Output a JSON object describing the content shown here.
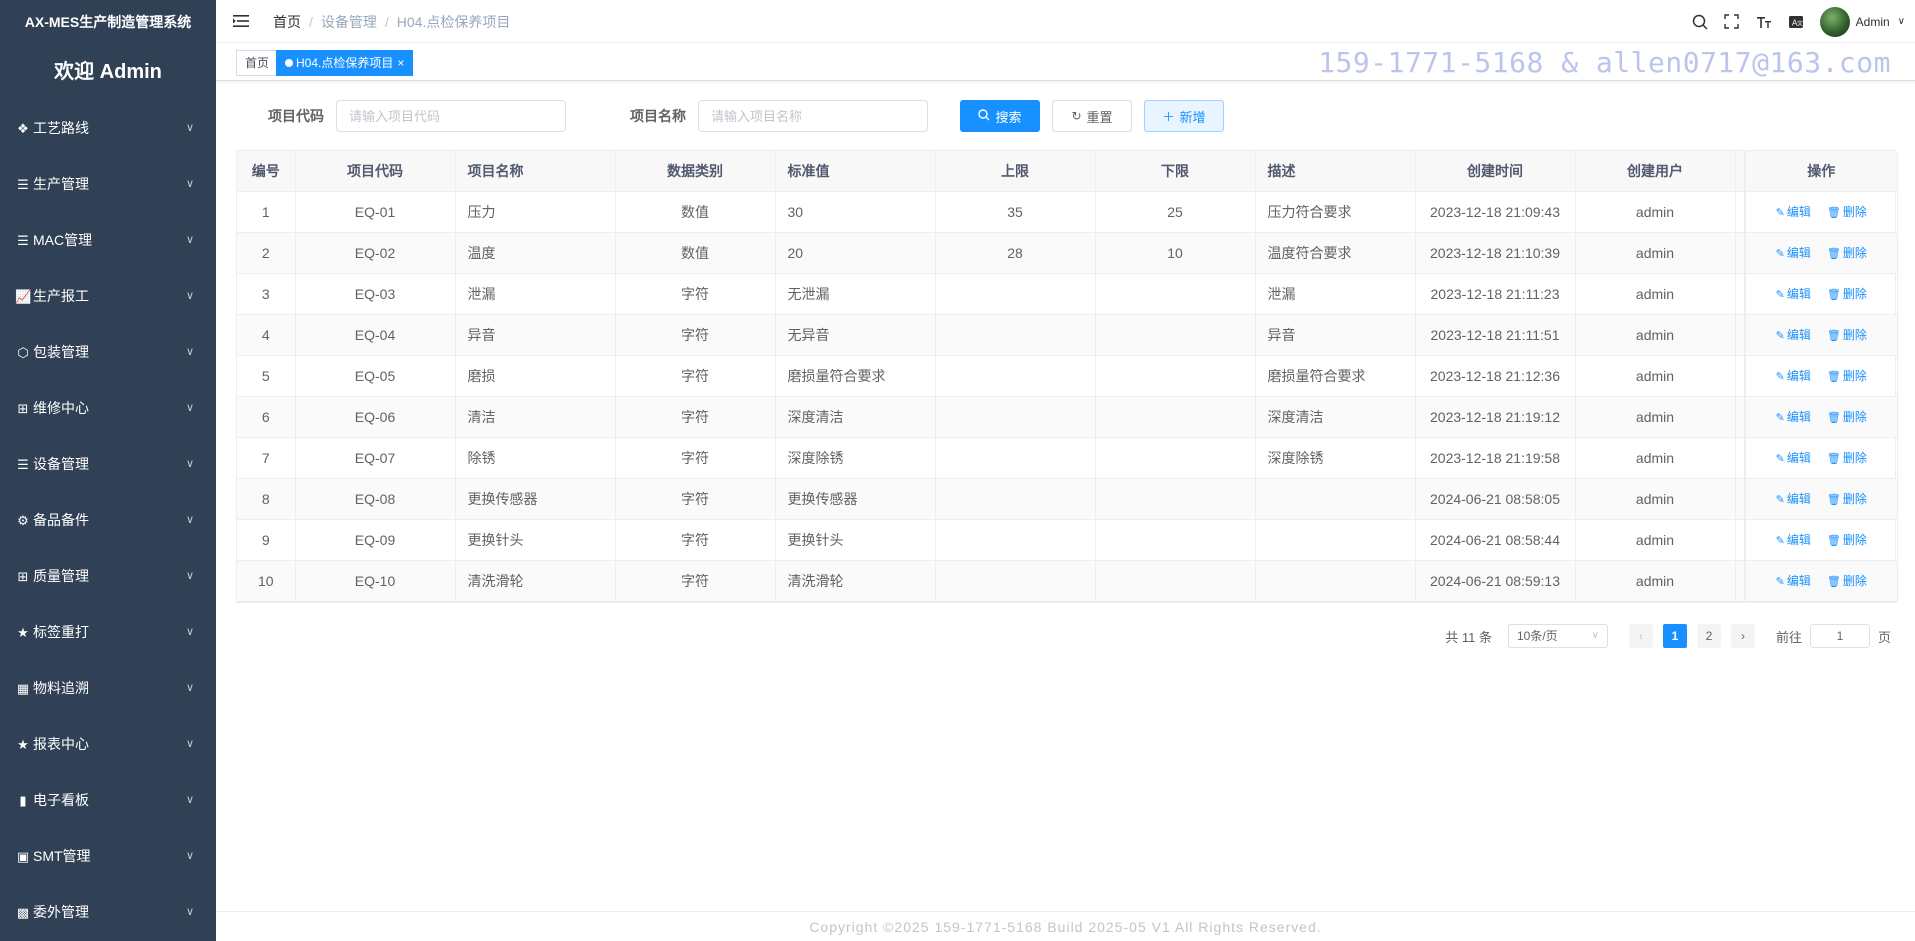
{
  "sidebar": {
    "system_title": "AX-MES生产制造管理系统",
    "welcome": "欢迎 Admin",
    "items": [
      {
        "label": "工艺路线",
        "icon": "route-icon"
      },
      {
        "label": "生产管理",
        "icon": "list-icon"
      },
      {
        "label": "MAC管理",
        "icon": "list-icon"
      },
      {
        "label": "生产报工",
        "icon": "chart-report-icon"
      },
      {
        "label": "包装管理",
        "icon": "box-icon"
      },
      {
        "label": "维修中心",
        "icon": "grid-icon"
      },
      {
        "label": "设备管理",
        "icon": "list-icon"
      },
      {
        "label": "备品备件",
        "icon": "puzzle-icon"
      },
      {
        "label": "质量管理",
        "icon": "grid-icon"
      },
      {
        "label": "标签重打",
        "icon": "star-icon"
      },
      {
        "label": "物料追溯",
        "icon": "table-icon"
      },
      {
        "label": "报表中心",
        "icon": "star-icon"
      },
      {
        "label": "电子看板",
        "icon": "bar-chart-icon"
      },
      {
        "label": "SMT管理",
        "icon": "monitor-icon"
      },
      {
        "label": "委外管理",
        "icon": "apps-icon"
      }
    ]
  },
  "navbar": {
    "breadcrumb": [
      "首页",
      "设备管理",
      "H04.点检保养项目"
    ],
    "user": "Admin"
  },
  "tags": {
    "home": "首页",
    "active": "H04.点检保养项目"
  },
  "watermark": "159-1771-5168 & allen0717@163.com",
  "search": {
    "code_label": "项目代码",
    "code_placeholder": "请输入项目代码",
    "name_label": "项目名称",
    "name_placeholder": "请输入项目名称",
    "search_btn": "搜索",
    "reset_btn": "重置",
    "add_btn": "新增"
  },
  "table": {
    "headers": [
      "编号",
      "项目代码",
      "项目名称",
      "数据类别",
      "标准值",
      "上限",
      "下限",
      "描述",
      "创建时间",
      "创建用户",
      "操作"
    ],
    "edit_label": "编辑",
    "delete_label": "删除",
    "rows": [
      {
        "no": "1",
        "code": "EQ-01",
        "name": "压力",
        "type": "数值",
        "std": "30",
        "upper": "35",
        "lower": "25",
        "desc": "压力符合要求",
        "time": "2023-12-18 21:09:43",
        "user": "admin"
      },
      {
        "no": "2",
        "code": "EQ-02",
        "name": "温度",
        "type": "数值",
        "std": "20",
        "upper": "28",
        "lower": "10",
        "desc": "温度符合要求",
        "time": "2023-12-18 21:10:39",
        "user": "admin"
      },
      {
        "no": "3",
        "code": "EQ-03",
        "name": "泄漏",
        "type": "字符",
        "std": "无泄漏",
        "upper": "",
        "lower": "",
        "desc": "泄漏",
        "time": "2023-12-18 21:11:23",
        "user": "admin"
      },
      {
        "no": "4",
        "code": "EQ-04",
        "name": "异音",
        "type": "字符",
        "std": "无异音",
        "upper": "",
        "lower": "",
        "desc": "异音",
        "time": "2023-12-18 21:11:51",
        "user": "admin"
      },
      {
        "no": "5",
        "code": "EQ-05",
        "name": "磨损",
        "type": "字符",
        "std": "磨损量符合要求",
        "upper": "",
        "lower": "",
        "desc": "磨损量符合要求",
        "time": "2023-12-18 21:12:36",
        "user": "admin"
      },
      {
        "no": "6",
        "code": "EQ-06",
        "name": "清洁",
        "type": "字符",
        "std": "深度清洁",
        "upper": "",
        "lower": "",
        "desc": "深度清洁",
        "time": "2023-12-18 21:19:12",
        "user": "admin"
      },
      {
        "no": "7",
        "code": "EQ-07",
        "name": "除锈",
        "type": "字符",
        "std": "深度除锈",
        "upper": "",
        "lower": "",
        "desc": "深度除锈",
        "time": "2023-12-18 21:19:58",
        "user": "admin"
      },
      {
        "no": "8",
        "code": "EQ-08",
        "name": "更换传感器",
        "type": "字符",
        "std": "更换传感器",
        "upper": "",
        "lower": "",
        "desc": "",
        "time": "2024-06-21 08:58:05",
        "user": "admin"
      },
      {
        "no": "9",
        "code": "EQ-09",
        "name": "更换针头",
        "type": "字符",
        "std": "更换针头",
        "upper": "",
        "lower": "",
        "desc": "",
        "time": "2024-06-21 08:58:44",
        "user": "admin"
      },
      {
        "no": "10",
        "code": "EQ-10",
        "name": "清洗滑轮",
        "type": "字符",
        "std": "清洗滑轮",
        "upper": "",
        "lower": "",
        "desc": "",
        "time": "2024-06-21 08:59:13",
        "user": "admin"
      }
    ]
  },
  "pagination": {
    "total": "共 11 条",
    "page_size": "10条/页",
    "pages": [
      "1",
      "2"
    ],
    "current": "1",
    "goto_label": "前往",
    "goto_value": "1",
    "page_unit": "页"
  },
  "footer": "Copyright ©2025 159-1771-5168 Build 2025-05 V1 All Rights Reserved.",
  "colors": {
    "sidebar_bg": "#304156",
    "primary": "#1890ff",
    "watermark": "#bcc4ec"
  }
}
